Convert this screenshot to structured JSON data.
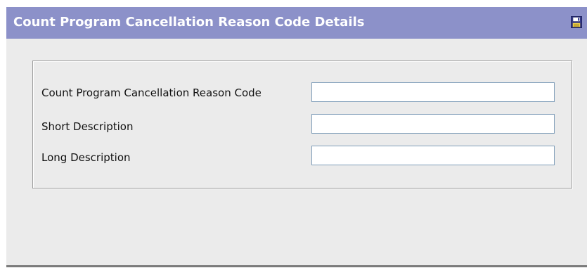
{
  "header": {
    "title": "Count Program Cancellation Reason Code Details",
    "save_icon": "floppy-disk-save-icon"
  },
  "form": {
    "fields": [
      {
        "label": "Count Program Cancellation Reason Code",
        "value": ""
      },
      {
        "label": "Short Description",
        "value": ""
      },
      {
        "label": "Long Description",
        "value": ""
      }
    ]
  },
  "colors": {
    "title_bar": "#8c91c9",
    "panel_background": "#ebebeb",
    "input_border": "#7f9db9"
  }
}
